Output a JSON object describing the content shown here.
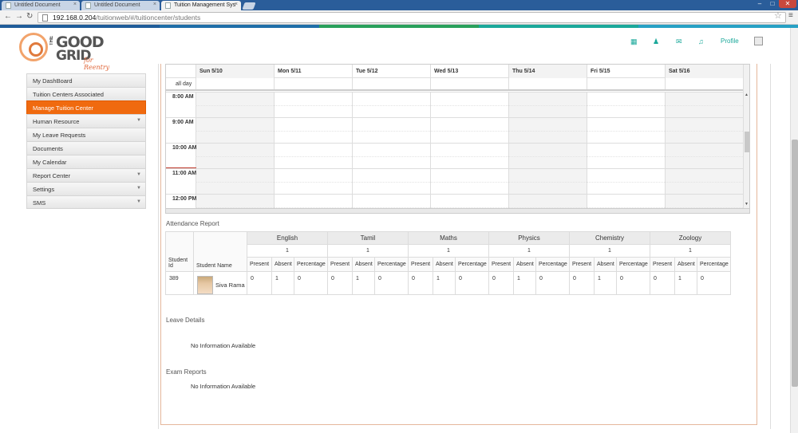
{
  "browser": {
    "tabs": [
      {
        "title": "Untitled Document",
        "active": false
      },
      {
        "title": "Untitled Document",
        "active": false
      },
      {
        "title": "Tuition Management Sys",
        "active": true
      }
    ],
    "url_host": "192.168.0.204",
    "url_path": "/tuitionweb/#/tuitioncenter/students",
    "back_icon": "←",
    "forward_icon": "→",
    "reload_icon": "↻",
    "star_icon": "☆",
    "menu_icon": "≡",
    "min_icon": "–",
    "max_icon": "□",
    "close_icon": "✕",
    "tab_close_icon": "×",
    "band_colors": [
      "#1f5c99",
      "#1f6ea8",
      "#29a05b",
      "#1aa89a",
      "#27a0c4"
    ]
  },
  "header": {
    "logo": {
      "the": "THE",
      "good": "GOOD",
      "grid": "GRID",
      "tagline": "for Reentry"
    },
    "icons": [
      "grid-icon",
      "users-icon",
      "mail-icon",
      "bell-icon"
    ],
    "icon_glyphs": [
      "▦",
      "♟",
      "✉",
      "♫"
    ],
    "profile_label": "Profile",
    "accent": "#1aa89a"
  },
  "sidebar": {
    "items": [
      {
        "label": "My DashBoard",
        "caret": ""
      },
      {
        "label": "Tuition Centers Associated",
        "caret": ""
      },
      {
        "label": "Manage Tuition Center",
        "caret": ""
      },
      {
        "label": "Human Resource",
        "caret": "▼"
      },
      {
        "label": "My Leave Requests",
        "caret": ""
      },
      {
        "label": "Documents",
        "caret": ""
      },
      {
        "label": "My Calendar",
        "caret": ""
      },
      {
        "label": "Report Center",
        "caret": "▼"
      },
      {
        "label": "Settings",
        "caret": "▼"
      },
      {
        "label": "SMS",
        "caret": "▼"
      }
    ],
    "active_index": 2,
    "active_color": "#f06a0f"
  },
  "calendar": {
    "days": [
      "Sun 5/10",
      "Mon 5/11",
      "Tue 5/12",
      "Wed 5/13",
      "Thu 5/14",
      "Fri 5/15",
      "Sat 5/16"
    ],
    "all_day_label": "all day",
    "hours": [
      "8:00 AM",
      "9:00 AM",
      "10:00 AM",
      "11:00 AM",
      "12:00 PM"
    ]
  },
  "attendance": {
    "title": "Attendance Report",
    "subjects": [
      {
        "name": "English",
        "count": "1"
      },
      {
        "name": "Tamil",
        "count": "1"
      },
      {
        "name": "Maths",
        "count": "1"
      },
      {
        "name": "Physics",
        "count": "1"
      },
      {
        "name": "Chemistry",
        "count": "1"
      },
      {
        "name": "Zoology",
        "count": "1"
      }
    ],
    "student_id_header": "Student Id",
    "student_name_header": "Student Name",
    "sub_headers": [
      "Present",
      "Absent",
      "Percentage"
    ],
    "rows": [
      {
        "id": "389",
        "name": "Siva Rama",
        "values": [
          [
            "0",
            "1",
            "0"
          ],
          [
            "0",
            "1",
            "0"
          ],
          [
            "0",
            "1",
            "0"
          ],
          [
            "0",
            "1",
            "0"
          ],
          [
            "0",
            "1",
            "0"
          ],
          [
            "0",
            "1",
            "0"
          ]
        ]
      }
    ]
  },
  "leave": {
    "title": "Leave Details",
    "empty": "No Information Available"
  },
  "exam": {
    "title": "Exam Reports",
    "empty": "No Information Available"
  }
}
